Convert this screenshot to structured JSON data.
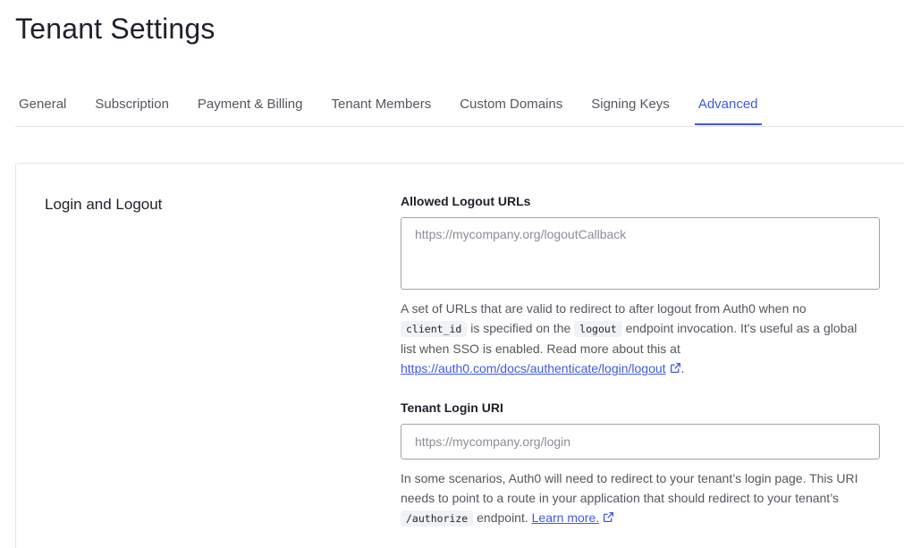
{
  "page": {
    "title": "Tenant Settings"
  },
  "tabs": [
    {
      "label": "General"
    },
    {
      "label": "Subscription"
    },
    {
      "label": "Payment & Billing"
    },
    {
      "label": "Tenant Members"
    },
    {
      "label": "Custom Domains"
    },
    {
      "label": "Signing Keys"
    },
    {
      "label": "Advanced",
      "active": true
    }
  ],
  "section": {
    "title": "Login and Logout"
  },
  "logout_urls": {
    "label": "Allowed Logout URLs",
    "value": "",
    "placeholder": "https://mycompany.org/logoutCallback",
    "help_1": "A set of URLs that are valid to redirect to after logout from Auth0 when no",
    "code_1": "client_id",
    "help_2": " is specified on the ",
    "code_2": "logout",
    "help_3": " endpoint invocation. It's useful as a global list when SSO is enabled. Read more about this at ",
    "link": "https://auth0.com/docs/authenticate/login/logout",
    "help_4": "."
  },
  "login_uri": {
    "label": "Tenant Login URI",
    "value": "",
    "placeholder": "https://mycompany.org/login",
    "help_1": "In some scenarios, Auth0 will need to redirect to your tenant’s login page. This URI needs to point to a route in your application that should redirect to your tenant’s ",
    "code_1": "/authorize",
    "help_2": " endpoint. ",
    "link": "Learn more."
  },
  "colors": {
    "accent": "#3f59e4",
    "text": "#1e212a",
    "muted": "#53575f",
    "border": "#e3e4e8"
  }
}
